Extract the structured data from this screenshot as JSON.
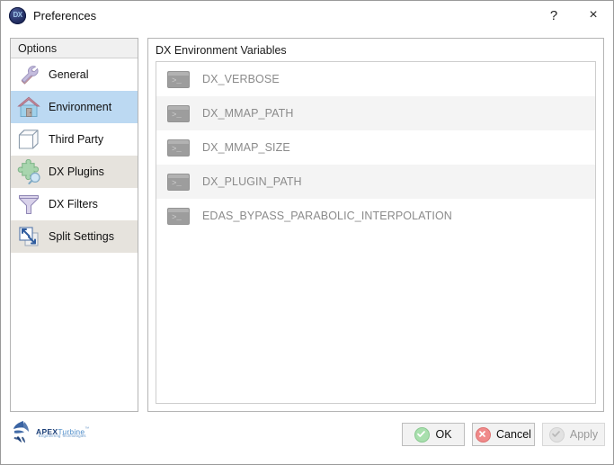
{
  "window": {
    "title": "Preferences",
    "app_icon_text": "DX",
    "help_button": "?",
    "close_button": "×"
  },
  "sidebar": {
    "header": "Options",
    "items": [
      {
        "label": "General",
        "icon": "tools-icon",
        "selected": false,
        "alt": false
      },
      {
        "label": "Environment",
        "icon": "house-icon",
        "selected": true,
        "alt": false
      },
      {
        "label": "Third Party",
        "icon": "cube-icon",
        "selected": false,
        "alt": false
      },
      {
        "label": "DX Plugins",
        "icon": "puzzle-icon",
        "selected": false,
        "alt": true
      },
      {
        "label": "DX Filters",
        "icon": "funnel-icon",
        "selected": false,
        "alt": false
      },
      {
        "label": "Split Settings",
        "icon": "split-icon",
        "selected": false,
        "alt": true
      }
    ]
  },
  "main": {
    "title": "DX Environment Variables",
    "variables": [
      {
        "name": "DX_VERBOSE",
        "icon": "terminal-icon",
        "alt": false
      },
      {
        "name": "DX_MMAP_PATH",
        "icon": "terminal-icon",
        "alt": true
      },
      {
        "name": "DX_MMAP_SIZE",
        "icon": "terminal-icon",
        "alt": false
      },
      {
        "name": "DX_PLUGIN_PATH",
        "icon": "terminal-icon",
        "alt": true
      },
      {
        "name": "EDAS_BYPASS_PARABOLIC_INTERPOLATION",
        "icon": "terminal-icon",
        "alt": false
      }
    ]
  },
  "footer": {
    "logo": {
      "brand": "APEX",
      "product": "Turbine",
      "trademark": "™",
      "tagline": "Engineering Technologies"
    },
    "buttons": [
      {
        "label": "OK",
        "icon": "check-circle-icon",
        "enabled": true
      },
      {
        "label": "Cancel",
        "icon": "x-circle-icon",
        "enabled": true
      },
      {
        "label": "Apply",
        "icon": "check-circle-icon",
        "enabled": false
      }
    ]
  },
  "colors": {
    "selection": "#bcd9f2",
    "alt_row": "#e6e3dd",
    "list_alt_row": "#f4f4f4",
    "ok_green": "#a8dfad",
    "cancel_red": "#f08a8a",
    "disabled_text": "#9a9a9a",
    "variable_text": "#8b8b8b",
    "brand_blue": "#1b3f78"
  }
}
